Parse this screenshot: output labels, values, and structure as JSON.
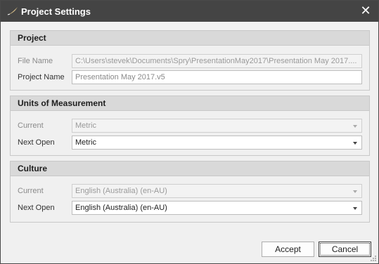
{
  "window": {
    "title": "Project Settings",
    "close_glyph": "✕"
  },
  "project": {
    "header": "Project",
    "file_name_label": "File Name",
    "file_name_value": "C:\\Users\\stevek\\Documents\\Spry\\PresentationMay2017\\Presentation May 2017....",
    "project_name_label": "Project Name",
    "project_name_value": "Presentation May 2017.v5"
  },
  "units": {
    "header": "Units of Measurement",
    "current_label": "Current",
    "current_value": "Metric",
    "next_open_label": "Next Open",
    "next_open_value": "Metric"
  },
  "culture": {
    "header": "Culture",
    "current_label": "Current",
    "current_value": "English (Australia) (en-AU)",
    "next_open_label": "Next Open",
    "next_open_value": "English (Australia) (en-AU)"
  },
  "buttons": {
    "accept": "Accept",
    "cancel": "Cancel"
  },
  "icons": {
    "app": "quill-icon",
    "close": "close-icon",
    "dropdown": "chevron-down-icon"
  },
  "colors": {
    "titlebar": "#444444",
    "group_header": "#d9d9d9",
    "background": "#f0f0f0"
  }
}
